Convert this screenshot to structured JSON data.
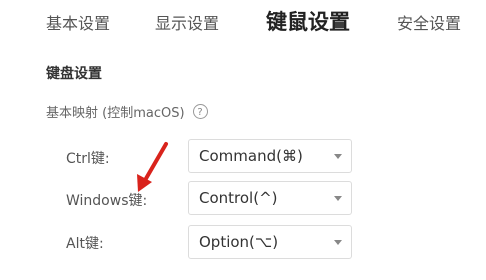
{
  "tabs": [
    {
      "label": "基本设置",
      "active": false
    },
    {
      "label": "显示设置",
      "active": false
    },
    {
      "label": "键鼠设置",
      "active": true
    },
    {
      "label": "安全设置",
      "active": false
    }
  ],
  "keyboard": {
    "section_title": "键盘设置",
    "mapping_label": "基本映射 (控制macOS)",
    "help_glyph": "?",
    "rows": [
      {
        "label": "Ctrl键:",
        "value": "Command(⌘)"
      },
      {
        "label": "Windows键:",
        "value": "Control(^)"
      },
      {
        "label": "Alt键:",
        "value": "Option(⌥)"
      }
    ]
  },
  "annotation": {
    "color": "#d9231c"
  },
  "colors": {
    "active_tab": "#222222",
    "tab": "#555555",
    "border": "#dcdcdc"
  },
  "icons": {
    "help": "question-circle-icon",
    "dropdown": "chevron-down-icon",
    "annotation": "red-arrow-icon"
  }
}
